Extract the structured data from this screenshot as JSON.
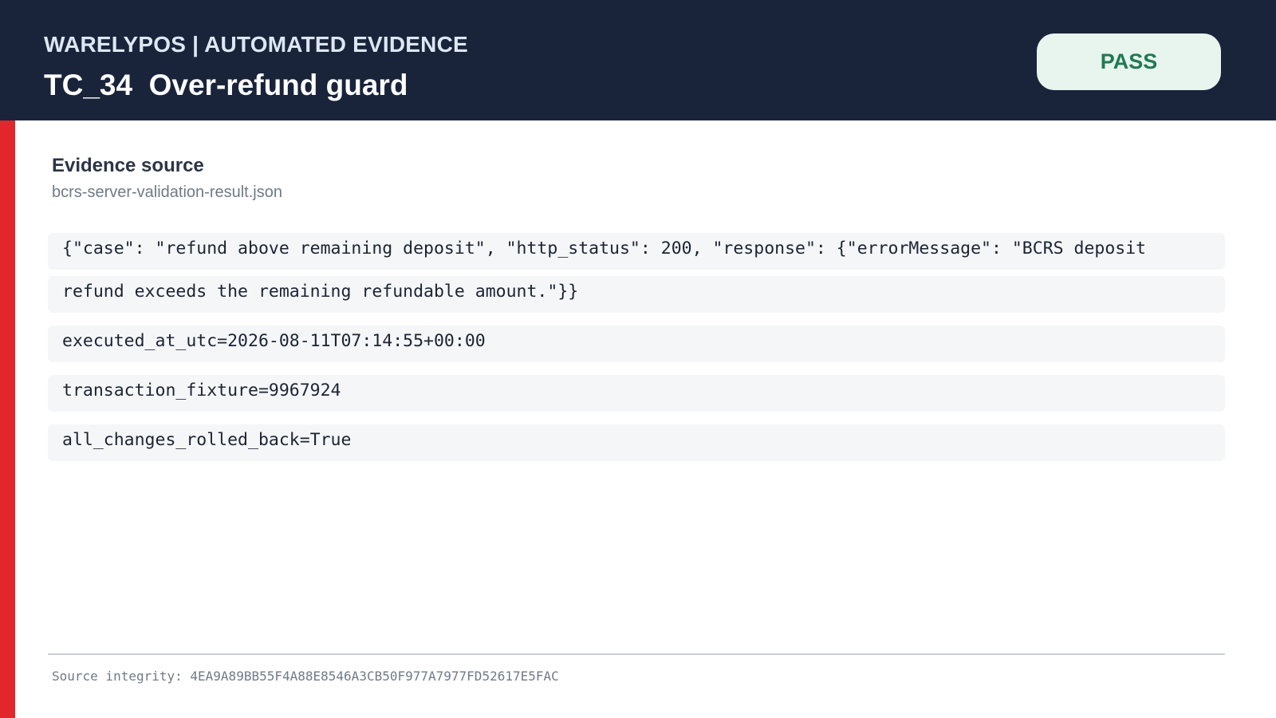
{
  "header": {
    "brand": "WARELYPOS  |  AUTOMATED EVIDENCE",
    "title": "TC_34  Over-refund guard",
    "status": "PASS",
    "colors": {
      "background": "#19243b",
      "status_text": "#207a52",
      "status_bg": "#e8f4ee"
    }
  },
  "accent_color": "#e1262c",
  "evidence": {
    "label": "Evidence source",
    "file": "bcrs-server-validation-result.json",
    "lines": [
      "{\"case\": \"refund above remaining deposit\", \"http_status\": 200, \"response\": {\"errorMessage\": \"BCRS deposit",
      "refund exceeds the remaining refundable amount.\"}}",
      "executed_at_utc=2026-08-11T07:14:55+00:00",
      "transaction_fixture=9967924",
      "all_changes_rolled_back=True"
    ]
  },
  "footer": {
    "integrity": "Source integrity: 4EA9A89BB55F4A88E8546A3CB50F977A7977FD52617E5FAC"
  }
}
